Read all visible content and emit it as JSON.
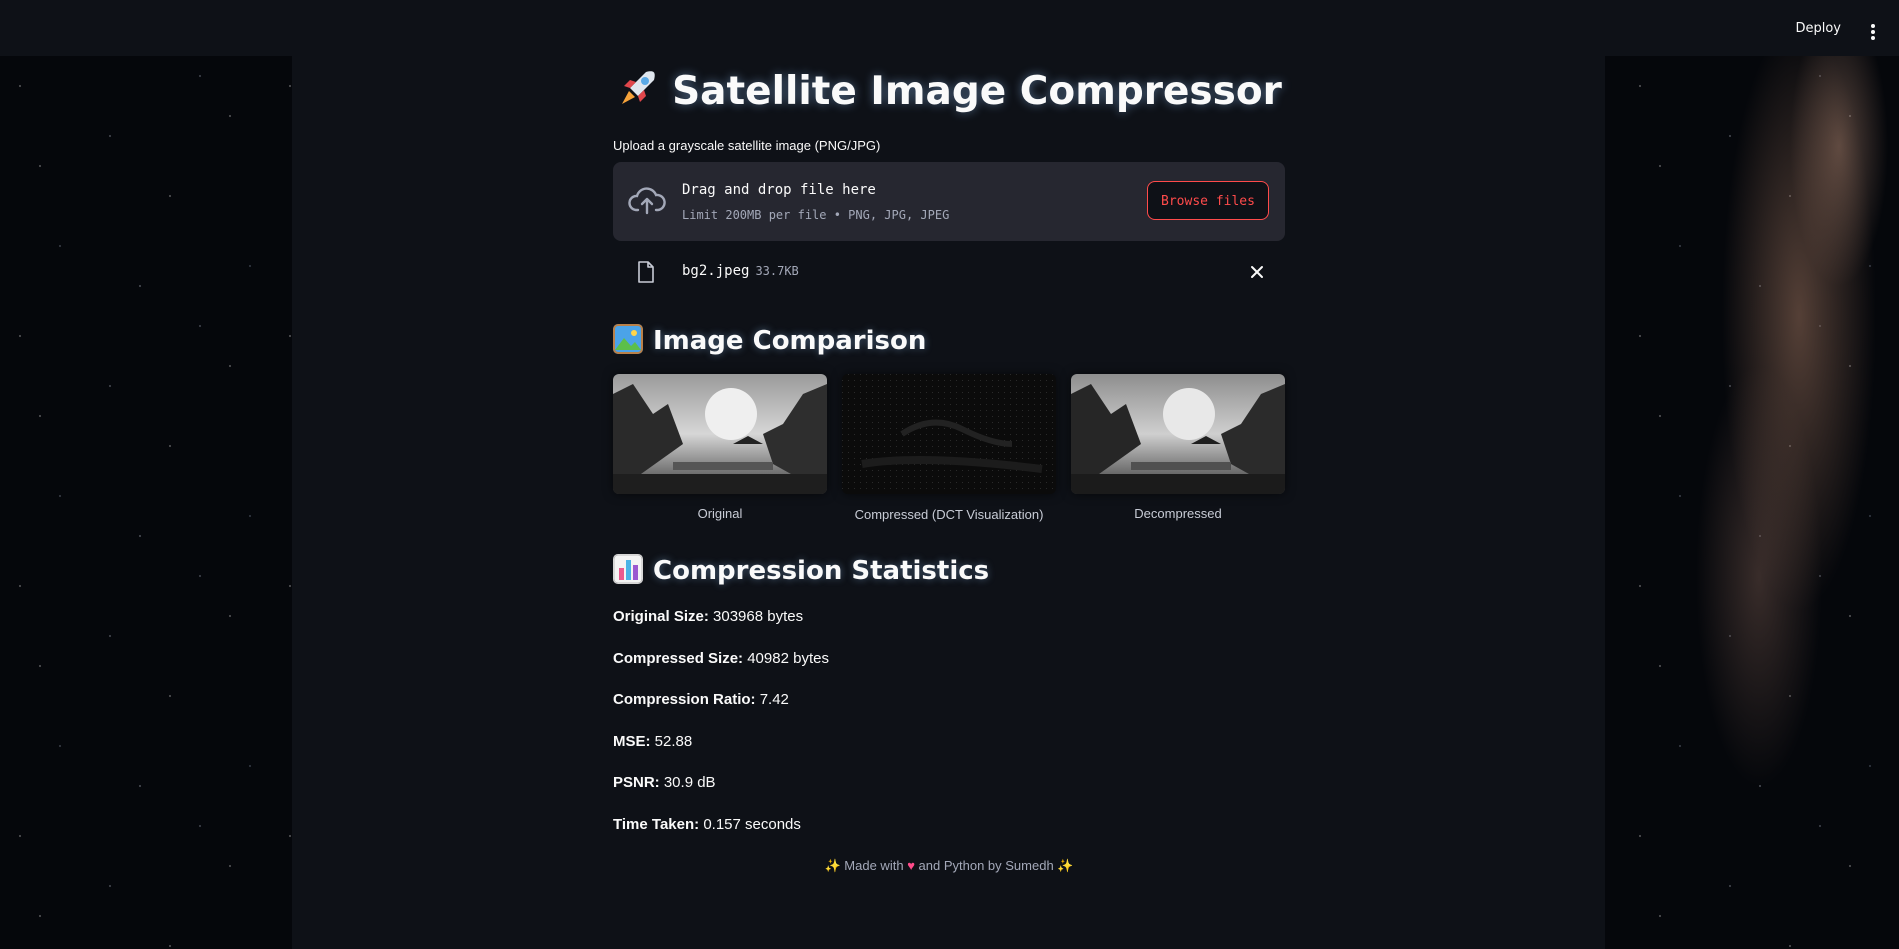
{
  "header": {
    "deploy_label": "Deploy"
  },
  "app": {
    "title": "Satellite Image Compressor",
    "title_icon": "rocket-icon"
  },
  "uploader": {
    "label": "Upload a grayscale satellite image (PNG/JPG)",
    "drop_title": "Drag and drop file here",
    "drop_sub": "Limit 200MB per file • PNG, JPG, JPEG",
    "browse_label": "Browse files",
    "file": {
      "name": "bg2.jpeg",
      "size": "33.7KB"
    }
  },
  "comparison": {
    "heading": "Image Comparison",
    "heading_icon": "framed-picture-icon",
    "images": [
      {
        "caption": "Original"
      },
      {
        "caption": "Compressed (DCT Visualization)"
      },
      {
        "caption": "Decompressed"
      }
    ]
  },
  "stats": {
    "heading": "Compression Statistics",
    "heading_icon": "bar-chart-icon",
    "items": [
      {
        "label": "Original Size:",
        "value": "303968 bytes"
      },
      {
        "label": "Compressed Size:",
        "value": "40982 bytes"
      },
      {
        "label": "Compression Ratio:",
        "value": "7.42"
      },
      {
        "label": "MSE:",
        "value": "52.88"
      },
      {
        "label": "PSNR:",
        "value": "30.9 dB"
      },
      {
        "label": "Time Taken:",
        "value": "0.157 seconds"
      }
    ]
  },
  "footer": {
    "prefix": "✨ Made with",
    "suffix": "and Python by Sumedh ✨"
  },
  "colors": {
    "accent": "#ff4b4b",
    "background": "#0e1117",
    "panel": "#262730"
  }
}
